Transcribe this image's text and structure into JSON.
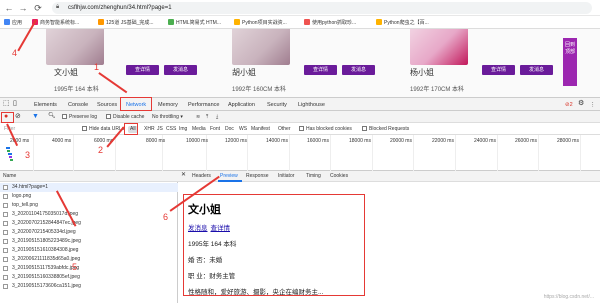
{
  "browser": {
    "url": "csflhjw.com/zhenghun/34.html?page=1",
    "bookmarks": [
      "应用",
      "商务智能系统标...",
      "125道 JS基础_完成...",
      "HTML简易式 HTM...",
      "Python项目实战资...",
      "使用python抓取珍...",
      "Python爬虫之【百..."
    ]
  },
  "page": {
    "cards": [
      {
        "name": "文小姐",
        "info": "1995年 164 本科",
        "btn1": "查详情",
        "btn2": "发消息"
      },
      {
        "name": "胡小姐",
        "info": "1992年 160CM 本科",
        "btn1": "查详情",
        "btn2": "发消息"
      },
      {
        "name": "杨小姐",
        "info": "1992年 170CM 本科",
        "btn1": "查详情",
        "btn2": "发消息"
      }
    ],
    "side_tab": "回到顶部"
  },
  "devtools": {
    "tabs": [
      "Elements",
      "Console",
      "Sources",
      "Network",
      "Memory",
      "Performance",
      "Application",
      "Security",
      "Lighthouse"
    ],
    "active_tab": "Network",
    "toolbar": {
      "preserve_log": "Preserve log",
      "disable_cache": "Disable cache",
      "throttle": "No throttling"
    },
    "filter": {
      "label": "Filter",
      "hide_data_urls": "Hide data URLs",
      "all": "All",
      "types": [
        "XHR",
        "JS",
        "CSS",
        "Img",
        "Media",
        "Font",
        "Doc",
        "WS",
        "Manifest",
        "Other"
      ],
      "has_blocked": "Has blocked cookies",
      "blocked_requests": "Blocked Requests"
    },
    "ticks": [
      "2000 ms",
      "4000 ms",
      "6000 ms",
      "8000 ms",
      "10000 ms",
      "12000 ms",
      "14000 ms",
      "16000 ms",
      "18000 ms",
      "20000 ms",
      "22000 ms",
      "24000 ms",
      "26000 ms",
      "28000 ms"
    ],
    "list_header": "Name",
    "requests": [
      "34.html?page=1",
      "logo.png",
      "top_tell.png",
      "3_20201104175035017d.jpeg",
      "3_20200702152844847ec.jpeg",
      "3_2020070215405334d.jpeg",
      "3_201905151805223489c.jpeg",
      "3_201905151610384308.jpeg",
      "3_20200621111835d65a0.jpeg",
      "3_20190515117539abfdc.jpeg",
      "3_20190515160338805ef.jpeg",
      "3_20190515173606ca151.jpeg"
    ],
    "detail_tabs": [
      "Headers",
      "Preview",
      "Response",
      "Initiator",
      "Timing",
      "Cookies"
    ],
    "active_detail_tab": "Preview",
    "preview": {
      "title": "文小姐",
      "links": [
        "发消息",
        "查详情"
      ],
      "lines": [
        "1995年 164 本科",
        "婚 否：未婚",
        "职 业：财务主管",
        "性格随和，爱好旅游、摄影，央企在编财务主..."
      ]
    }
  },
  "annotations": [
    "1",
    "2",
    "3",
    "4",
    "5",
    "6"
  ],
  "watermark": "https://blog.csdn.net/...",
  "colors": {
    "accent": "#6a1b9a",
    "devtools_blue": "#1a73e8",
    "annotation_red": "#e53935"
  }
}
